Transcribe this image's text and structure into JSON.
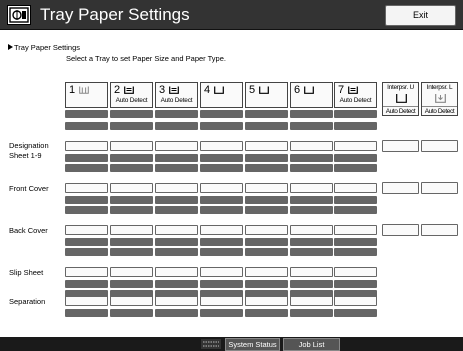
{
  "window": {
    "title": "Tray Paper Settings",
    "exit_label": "Exit"
  },
  "breadcrumb": "Tray Paper Settings",
  "instruction": "Select a Tray to set Paper Size and Paper Type.",
  "trays": [
    {
      "number": "1",
      "detect": ""
    },
    {
      "number": "2",
      "detect": "Auto Detect"
    },
    {
      "number": "3",
      "detect": "Auto Detect"
    },
    {
      "number": "4",
      "detect": ""
    },
    {
      "number": "5",
      "detect": ""
    },
    {
      "number": "6",
      "detect": ""
    },
    {
      "number": "7",
      "detect": "Auto Detect"
    }
  ],
  "interposers": [
    {
      "label": "Interpsr. U",
      "detect": "Auto Detect"
    },
    {
      "label": "Interpsr. L",
      "detect": "Auto Detect"
    }
  ],
  "rows": [
    {
      "label_lines": [
        "Designation",
        "Sheet 1-9"
      ]
    },
    {
      "label_lines": [
        "Front Cover"
      ]
    },
    {
      "label_lines": [
        "Back Cover"
      ]
    },
    {
      "label_lines": [
        "Slip Sheet"
      ]
    },
    {
      "label_lines": [
        "Separation"
      ]
    }
  ],
  "status_bar": {
    "system_status_label": "System Status",
    "job_list_label": "Job List"
  },
  "colors": {
    "titlebar": "#333333",
    "dark_cell": "#666666",
    "cell": "#fafafa",
    "statusbar": "#1a1a1a"
  }
}
